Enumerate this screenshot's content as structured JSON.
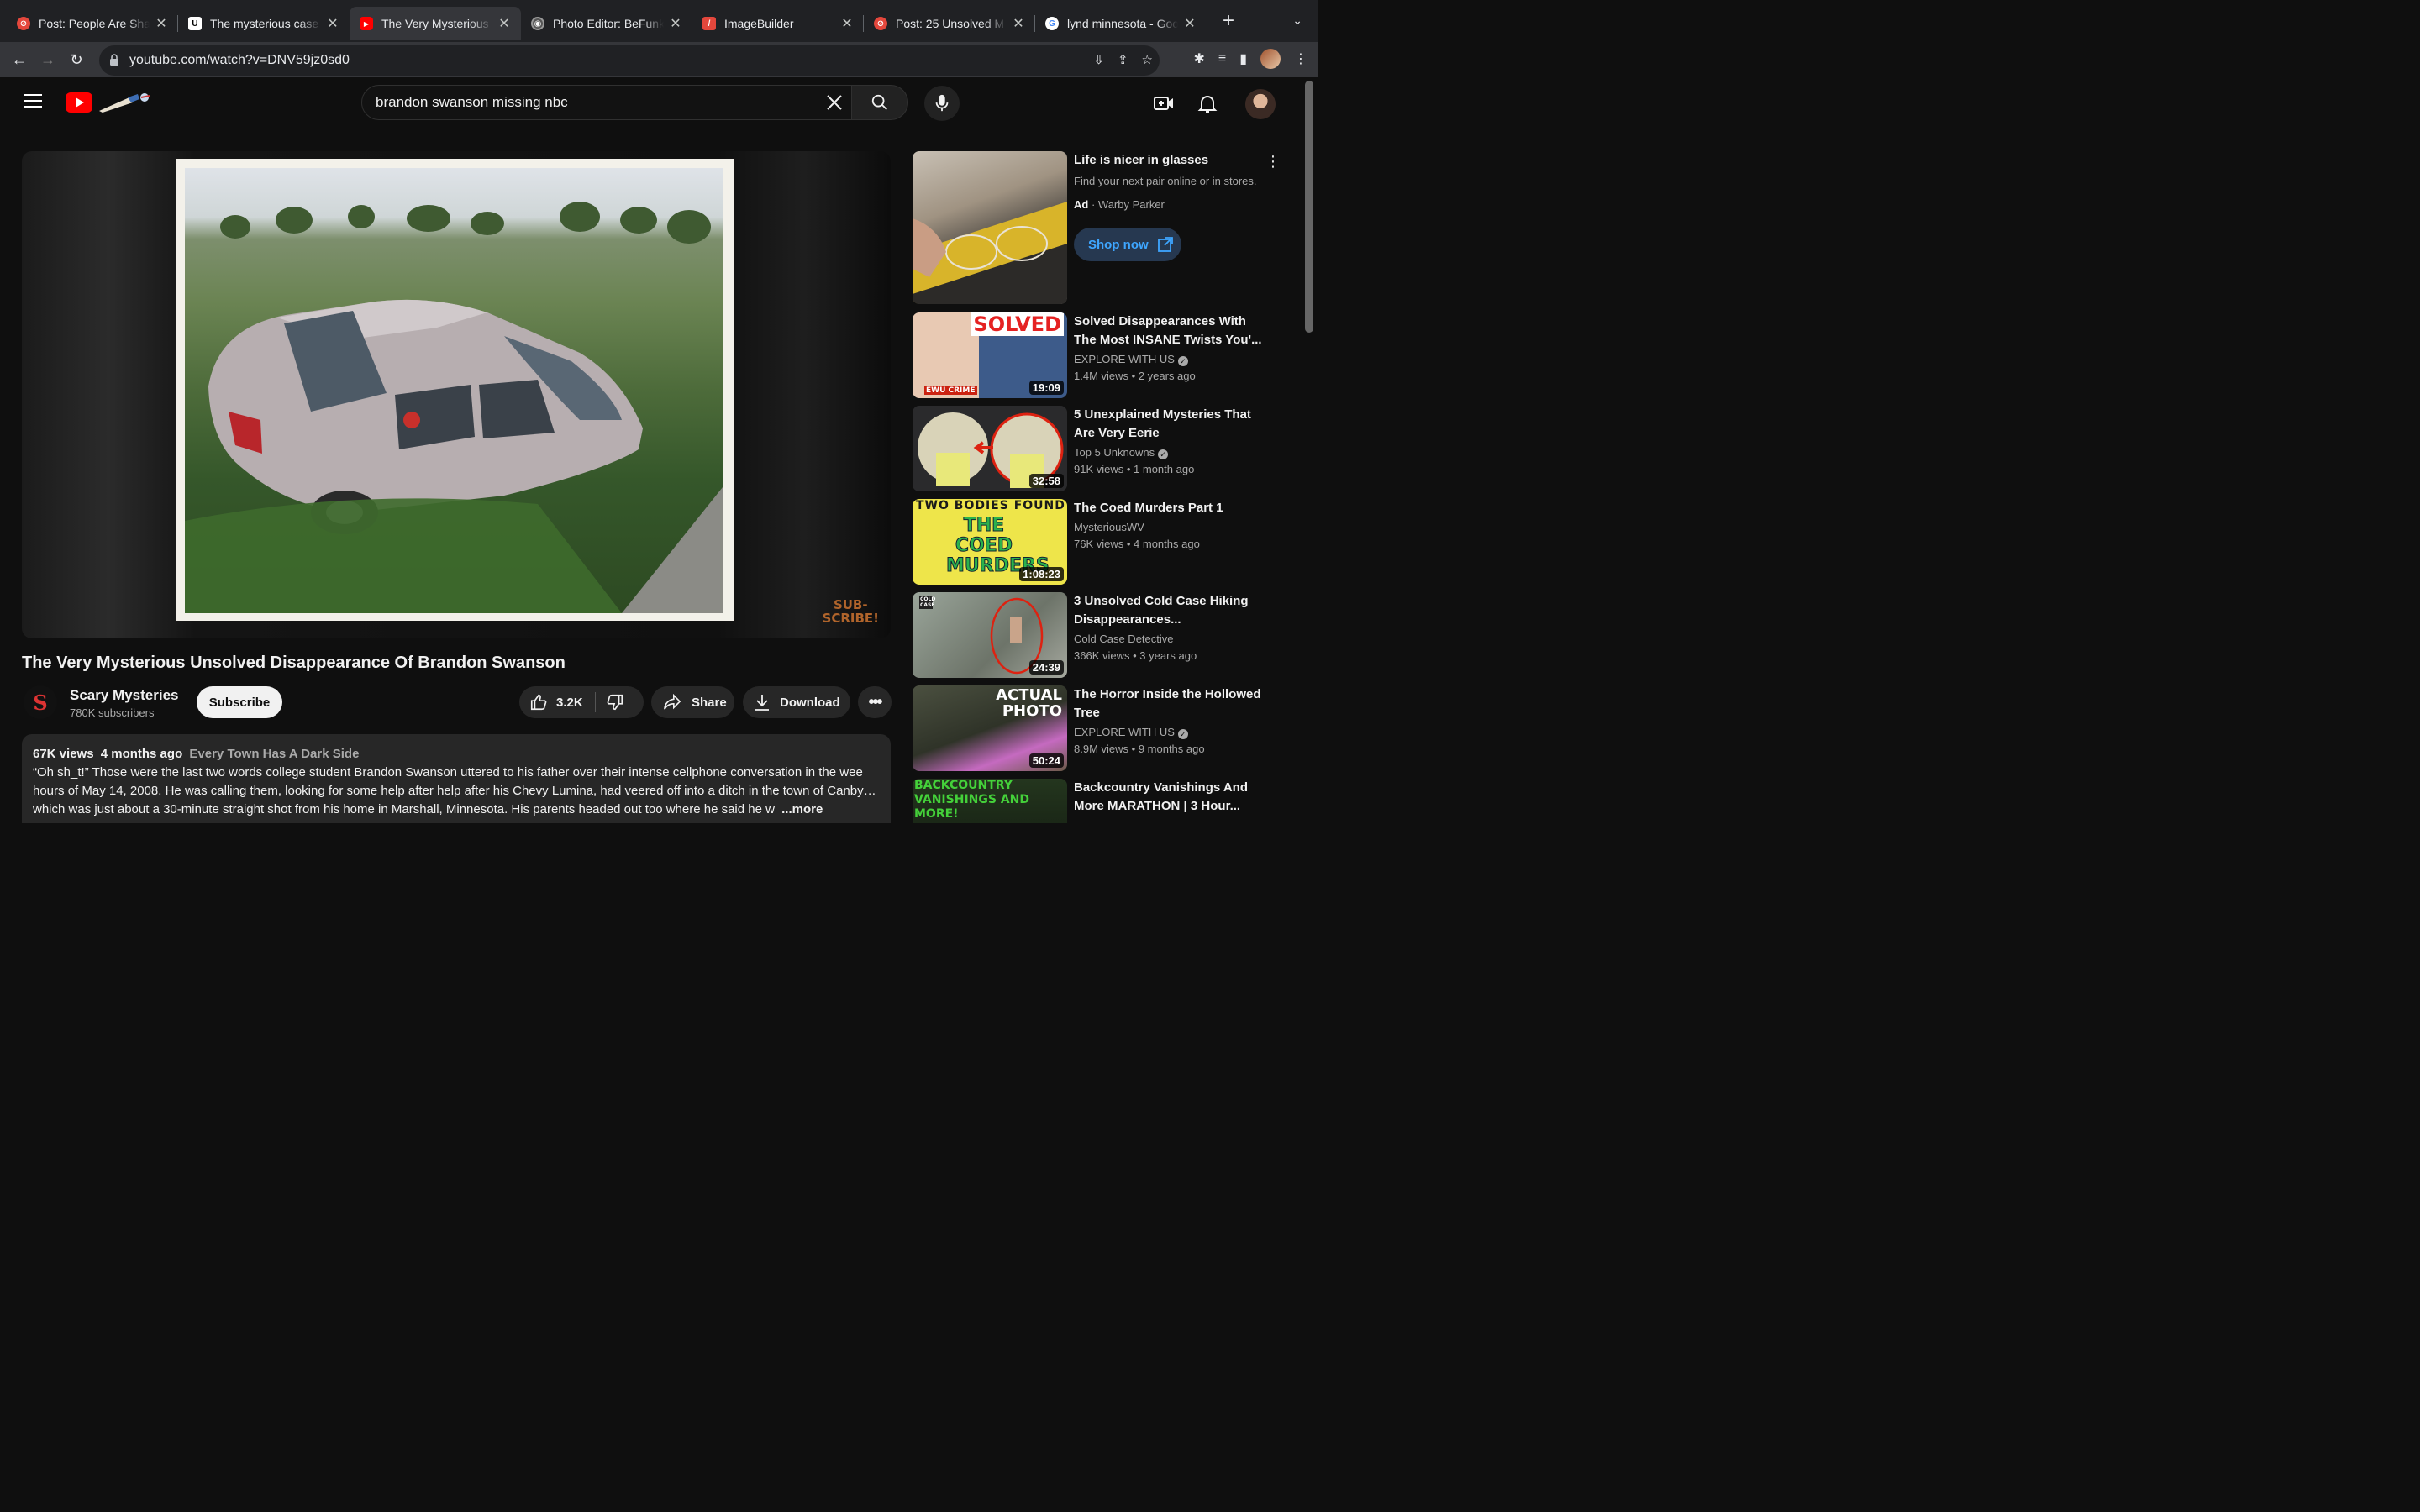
{
  "browser": {
    "tabs": [
      {
        "title": "Post: People Are Sha",
        "favicon_color": "#e4473c",
        "favicon_glyph": "⊘"
      },
      {
        "title": "The mysterious case",
        "favicon_color": "#000000",
        "favicon_glyph": "U"
      },
      {
        "title": "The Very Mysterious",
        "favicon_color": "#ff0000",
        "favicon_glyph": "▶"
      },
      {
        "title": "Photo Editor: BeFunk",
        "favicon_color": "#444444",
        "favicon_glyph": "◉"
      },
      {
        "title": "ImageBuilder",
        "favicon_color": "#e4473c",
        "favicon_glyph": "/"
      },
      {
        "title": "Post: 25 Unsolved M",
        "favicon_color": "#e4473c",
        "favicon_glyph": "⊘"
      },
      {
        "title": "lynd minnesota - Goo",
        "favicon_color": "#ffffff",
        "favicon_glyph": "G"
      }
    ],
    "active_tab": 2,
    "url": "youtube.com/watch?v=DNV59jz0sd0"
  },
  "youtube": {
    "search_query": "brandon swanson missing nbc",
    "video": {
      "title": "The Very Mysterious Unsolved Disappearance Of Brandon Swanson",
      "watermark": "SUB-\nSCRIBE!",
      "channel": "Scary Mysteries",
      "subscribers": "780K subscribers",
      "subscribe_label": "Subscribe",
      "likes": "3.2K",
      "share_label": "Share",
      "download_label": "Download",
      "views": "67K views",
      "age": "4 months ago",
      "tag": "Every Town Has A Dark Side",
      "description": "“Oh sh_t!” Those were the last two words college student Brandon Swanson uttered to his father over their intense cellphone conversation in the wee hours of May 14, 2008. He was calling them, looking for some help after help after his  Chevy Lumina, had veered off into a ditch in the town of Canby… which was just about a 30-minute straight shot from his home in Marshall, Minnesota. His parents headed out too where he said he w",
      "more_label": "...more"
    },
    "ad": {
      "title": "Life is nicer in glasses",
      "subtitle": "Find your next pair online or in stores.",
      "ad_label": "Ad",
      "advertiser": "Warby Parker",
      "cta": "Shop now"
    },
    "recommendations": [
      {
        "title": "Solved Disappearances With The Most INSANE Twists You'...",
        "channel": "EXPLORE WITH US",
        "verified": true,
        "views": "1.4M views",
        "age": "2 years ago",
        "duration": "19:09",
        "thumb_text": "SOLVED",
        "thumb_sub": "EWU CRIME"
      },
      {
        "title": "5 Unexplained Mysteries That Are Very Eerie",
        "channel": "Top 5 Unknowns",
        "verified": true,
        "views": "91K views",
        "age": "1 month ago",
        "duration": "32:58"
      },
      {
        "title": "The Coed Murders Part 1",
        "channel": "MysteriousWV",
        "verified": false,
        "views": "76K views",
        "age": "4 months ago",
        "duration": "1:08:23",
        "thumb_text": "TWO BODIES FOUND",
        "thumb_sub": "THE COED MURDERS"
      },
      {
        "title": "3 Unsolved Cold Case Hiking Disappearances...",
        "channel": "Cold Case Detective",
        "verified": false,
        "views": "366K views",
        "age": "3 years ago",
        "duration": "24:39",
        "thumb_text": "COLD CASE"
      },
      {
        "title": "The Horror Inside the Hollowed Tree",
        "channel": "EXPLORE WITH US",
        "verified": true,
        "views": "8.9M views",
        "age": "9 months ago",
        "duration": "50:24",
        "thumb_text": "ACTUAL PHOTO"
      },
      {
        "title": "Backcountry Vanishings And More MARATHON | 3 Hour...",
        "channel": "",
        "verified": false,
        "views": "",
        "age": "",
        "duration": "",
        "thumb_text": "BACKCOUNTRY VANISHINGS AND MORE!"
      }
    ]
  }
}
